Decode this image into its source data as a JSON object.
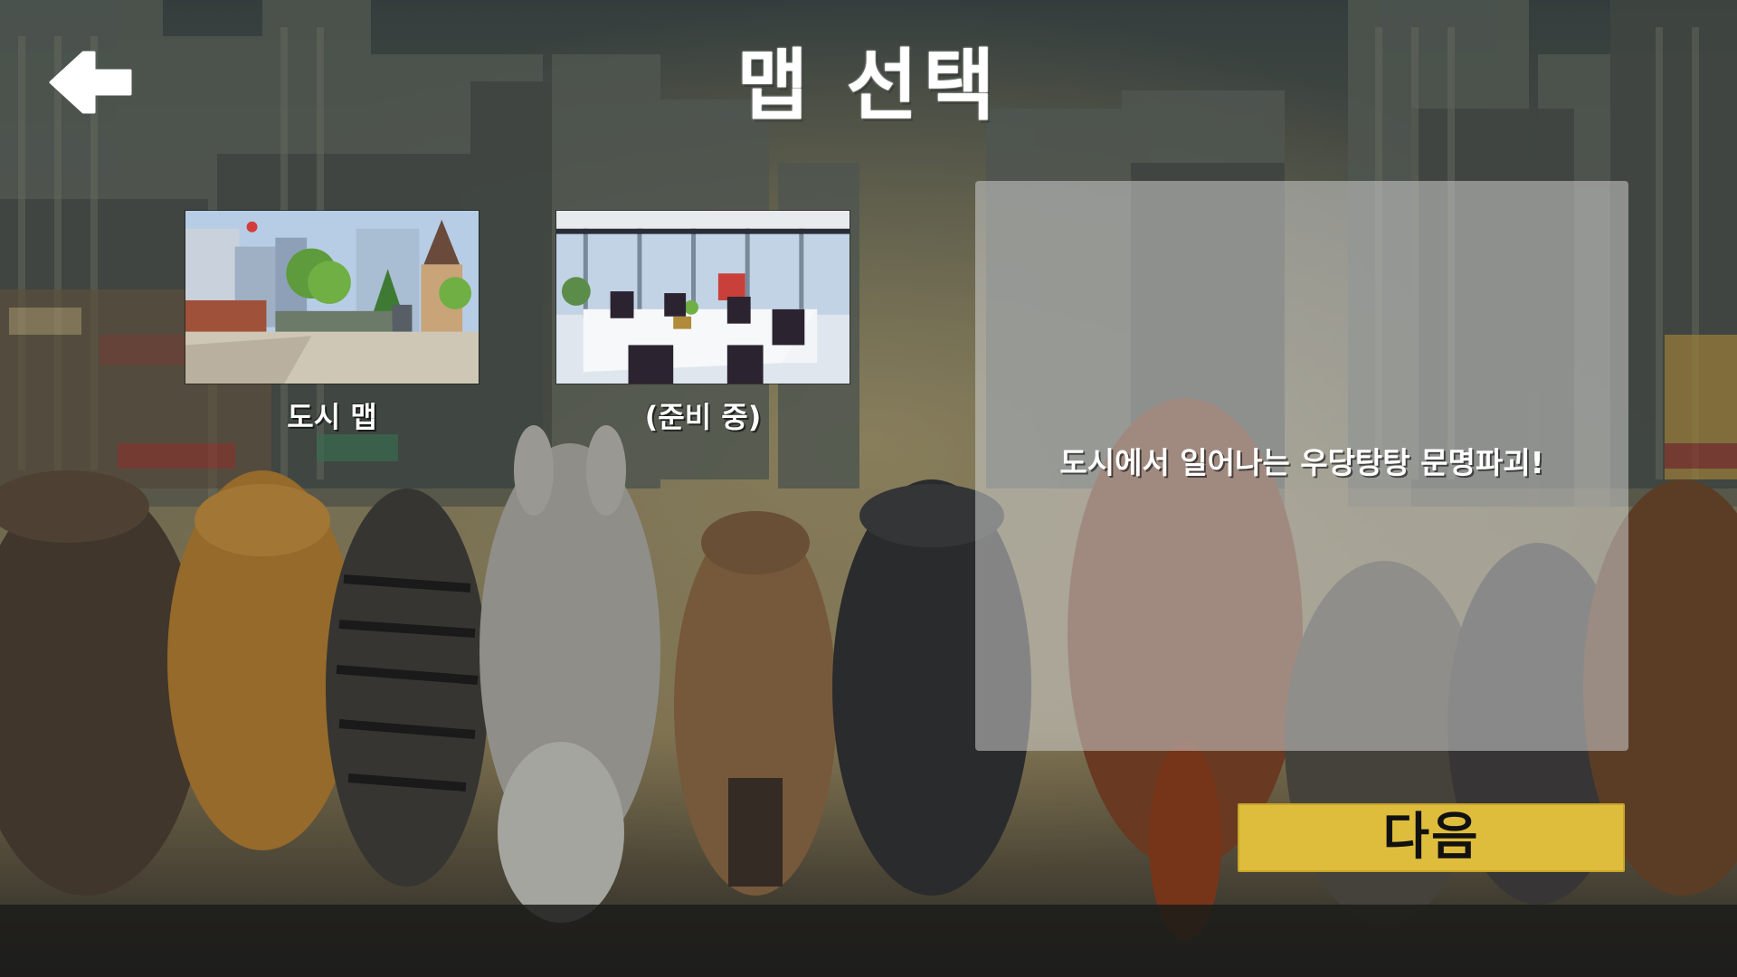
{
  "screen": {
    "title": "맵 선택"
  },
  "header": {
    "back_icon": "arrow-left-icon"
  },
  "maps": [
    {
      "label": "도시 맵",
      "thumbnail": "city-street-scene"
    },
    {
      "label": "(준비 중)",
      "thumbnail": "office-meeting-room-scene"
    }
  ],
  "description": {
    "text": "도시에서 일어나는 우당탕탕 문명파괴!"
  },
  "actions": {
    "next_label": "다음"
  },
  "colors": {
    "accent_button": "#dfbd3c",
    "panel": "#cdcdcd",
    "title_text": "#ffffff"
  }
}
